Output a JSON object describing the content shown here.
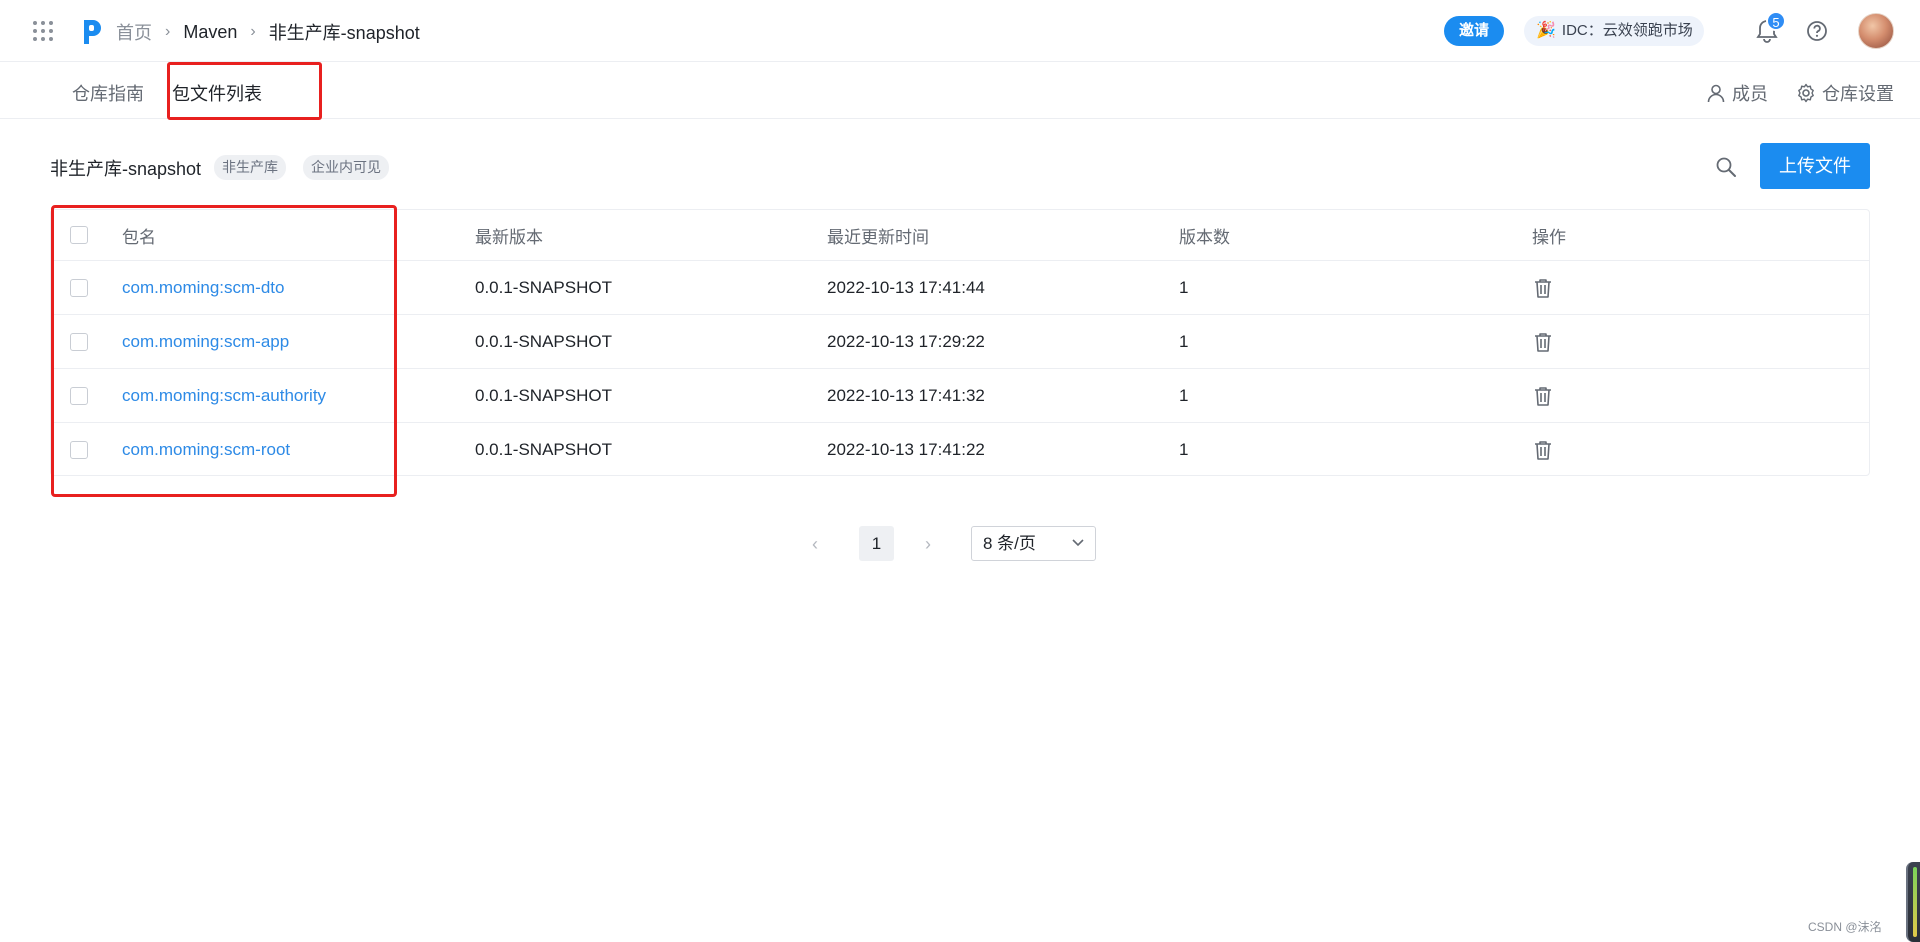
{
  "header": {
    "breadcrumb": {
      "home": "首页",
      "section": "Maven",
      "current": "非生产库-snapshot"
    },
    "invite_label": "邀请",
    "idc_label": "IDC：云效领跑市场",
    "notification_count": "5"
  },
  "subnav": {
    "tabs": [
      {
        "label": "仓库指南"
      },
      {
        "label": "包文件列表"
      }
    ],
    "members_label": "成员",
    "settings_label": "仓库设置"
  },
  "repo": {
    "name": "非生产库-snapshot",
    "tags": [
      "非生产库",
      "企业内可见"
    ],
    "upload_label": "上传文件"
  },
  "table": {
    "columns": [
      "包名",
      "最新版本",
      "最近更新时间",
      "版本数",
      "操作"
    ],
    "rows": [
      {
        "name": "com.moming:scm-dto",
        "version": "0.0.1-SNAPSHOT",
        "updated": "2022-10-13 17:41:44",
        "count": "1"
      },
      {
        "name": "com.moming:scm-app",
        "version": "0.0.1-SNAPSHOT",
        "updated": "2022-10-13 17:29:22",
        "count": "1"
      },
      {
        "name": "com.moming:scm-authority",
        "version": "0.0.1-SNAPSHOT",
        "updated": "2022-10-13 17:41:32",
        "count": "1"
      },
      {
        "name": "com.moming:scm-root",
        "version": "0.0.1-SNAPSHOT",
        "updated": "2022-10-13 17:41:22",
        "count": "1"
      }
    ]
  },
  "pagination": {
    "current_page": "1",
    "page_size": "8 条/页"
  },
  "watermark": "CSDN @沫洺",
  "colors": {
    "primary": "#1b8cf0",
    "link": "#2d8ae6",
    "highlight": "#e8201f"
  }
}
